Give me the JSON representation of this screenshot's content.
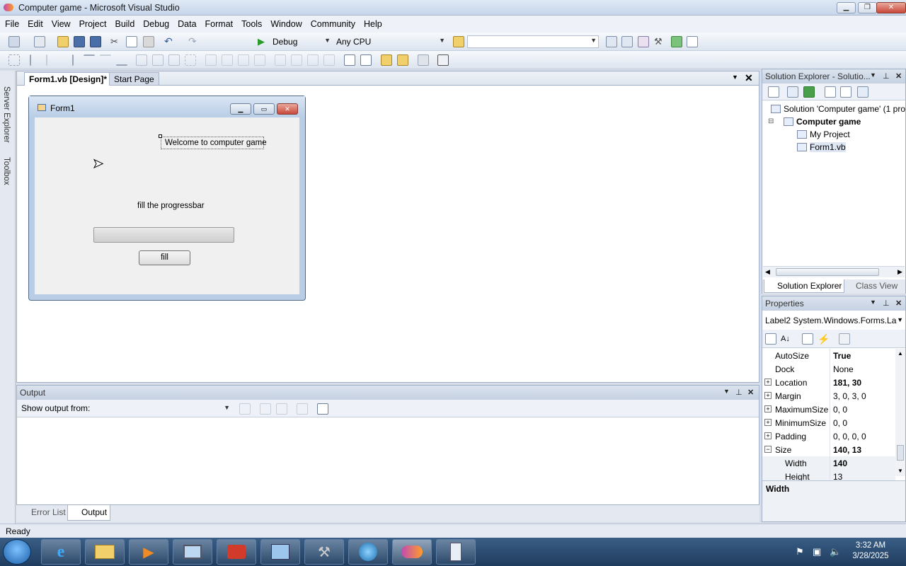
{
  "window": {
    "title": "Computer game - Microsoft Visual Studio"
  },
  "menu": [
    "File",
    "Edit",
    "View",
    "Project",
    "Build",
    "Debug",
    "Data",
    "Format",
    "Tools",
    "Window",
    "Community",
    "Help"
  ],
  "toolbar": {
    "config": "Debug",
    "platform": "Any CPU"
  },
  "side_tabs": {
    "server_explorer": "Server Explorer",
    "toolbox": "Toolbox"
  },
  "editor": {
    "tabs": [
      {
        "label": "Form1.vb [Design]*"
      },
      {
        "label": "Start Page"
      }
    ],
    "form": {
      "title": "Form1",
      "label1": "Welcome to computer game",
      "label2": "fill the progressbar",
      "progress": 0,
      "button": "fill"
    }
  },
  "solution_explorer": {
    "title": "Solution Explorer - Solutio...",
    "items": [
      "Solution 'Computer game' (1 pro",
      "Computer game",
      "My Project",
      "Form1.vb"
    ],
    "bottom_tabs": [
      "Solution Explorer",
      "Class View"
    ]
  },
  "properties": {
    "title": "Properties",
    "object": "Label2 System.Windows.Forms.La",
    "rows": [
      {
        "name": "AutoSize",
        "value": "True",
        "bold": true
      },
      {
        "name": "Dock",
        "value": "None"
      },
      {
        "name": "Location",
        "value": "181, 30",
        "bold": true,
        "expand": "+"
      },
      {
        "name": "Margin",
        "value": "3, 0, 3, 0",
        "expand": "+"
      },
      {
        "name": "MaximumSize",
        "value": "0, 0",
        "expand": "+"
      },
      {
        "name": "MinimumSize",
        "value": "0, 0",
        "expand": "+"
      },
      {
        "name": "Padding",
        "value": "0, 0, 0, 0",
        "expand": "+"
      },
      {
        "name": "Size",
        "value": "140, 13",
        "bold": true,
        "expand": "−"
      },
      {
        "name": "Width",
        "value": "140",
        "bold": true,
        "sub": true
      },
      {
        "name": "Height",
        "value": "13",
        "sub": true
      }
    ],
    "description_title": "Width"
  },
  "output": {
    "title": "Output",
    "show_from_label": "Show output from:",
    "bottom_tabs": [
      "Error List",
      "Output"
    ]
  },
  "status": {
    "text": "Ready"
  },
  "taskbar": {
    "time": "3:32 AM",
    "date": "3/28/2025"
  }
}
